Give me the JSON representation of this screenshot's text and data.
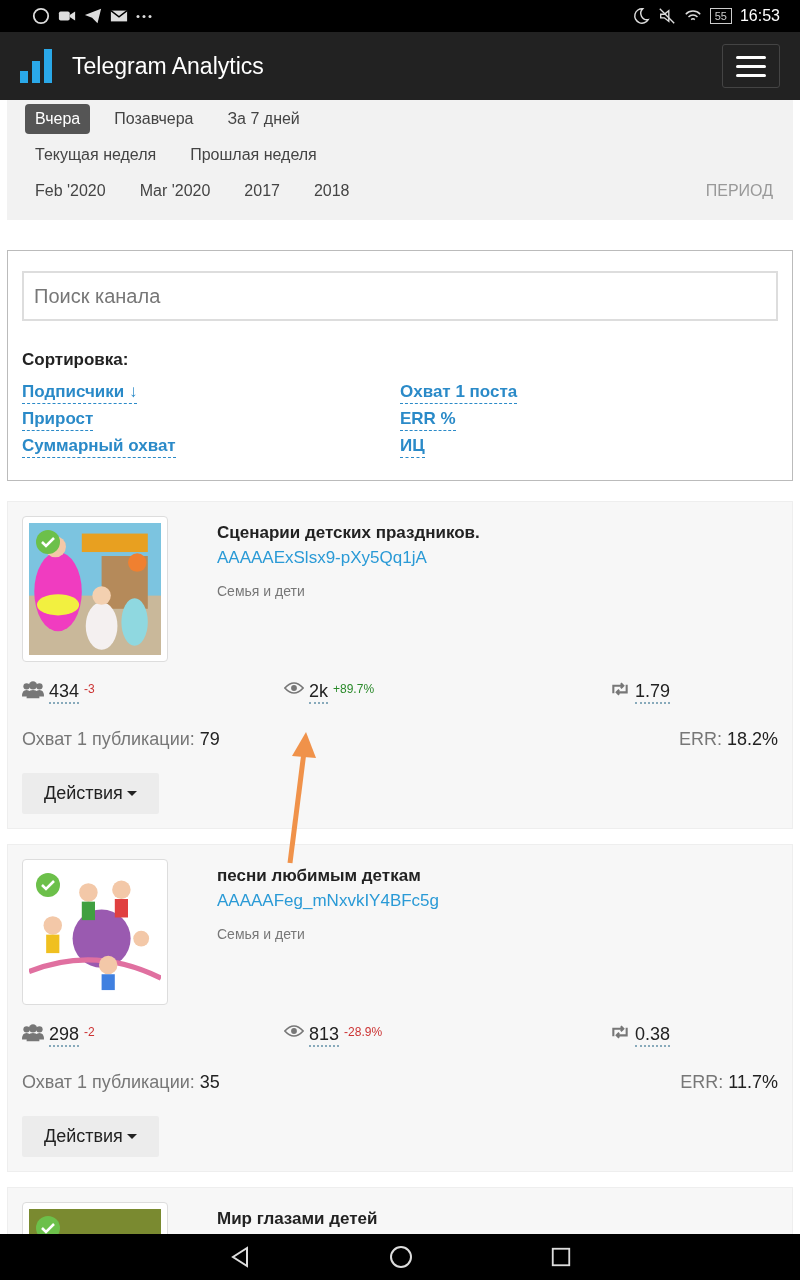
{
  "status_bar": {
    "battery": "55",
    "time": "16:53"
  },
  "navbar": {
    "title": "Telegram Analytics"
  },
  "periods": {
    "rows": [
      [
        {
          "label": "Вчера",
          "selected": true
        },
        {
          "label": "Позавчера",
          "selected": false
        },
        {
          "label": "За 7 дней",
          "selected": false
        }
      ],
      [
        {
          "label": "Текущая неделя",
          "selected": false
        },
        {
          "label": "Прошлая неделя",
          "selected": false
        }
      ],
      [
        {
          "label": "Feb '2020",
          "selected": false
        },
        {
          "label": "Mar '2020",
          "selected": false
        },
        {
          "label": "2017",
          "selected": false
        },
        {
          "label": "2018",
          "selected": false
        }
      ]
    ],
    "period_button": "ПЕРИОД"
  },
  "search": {
    "placeholder": "Поиск канала"
  },
  "sort": {
    "title": "Сортировка:",
    "options": [
      "Подписчики ↓",
      "Охват 1 поста",
      "Прирост",
      "ERR %",
      "Суммарный охват",
      "ИЦ"
    ]
  },
  "channels": [
    {
      "title": "Сценарии детских праздников.",
      "link": "AAAAAExSlsx9-pXy5Qq1jA",
      "category": "Семья и дети",
      "verified": true,
      "subscribers": "434",
      "subscribers_delta": "-3",
      "subscribers_delta_positive": false,
      "views": "2k",
      "views_delta": "+89.7%",
      "views_delta_positive": true,
      "reposts": "1.79",
      "reach_label": "Охват 1 публикации:",
      "reach": "79",
      "err_label": "ERR:",
      "err": "18.2%",
      "action": "Действия"
    },
    {
      "title": "песни любимым деткам",
      "link": "AAAAAFeg_mNxvkIY4BFc5g",
      "category": "Семья и дети",
      "verified": true,
      "subscribers": "298",
      "subscribers_delta": "-2",
      "subscribers_delta_positive": false,
      "views": "813",
      "views_delta": "-28.9%",
      "views_delta_positive": false,
      "reposts": "0.38",
      "reach_label": "Охват 1 публикации:",
      "reach": "35",
      "err_label": "ERR:",
      "err": "11.7%",
      "action": "Действия"
    },
    {
      "title": "Мир глазами детей",
      "verified": true
    }
  ]
}
